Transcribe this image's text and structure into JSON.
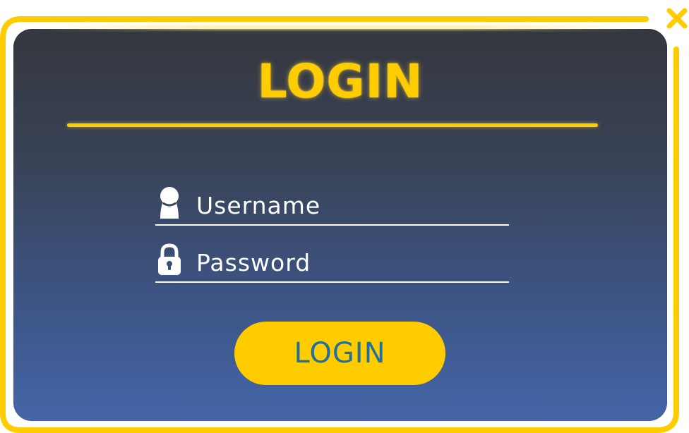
{
  "dialog": {
    "title": "LOGIN",
    "username": {
      "placeholder": "Username",
      "icon": "user-icon"
    },
    "password": {
      "placeholder": "Password",
      "icon": "lock-icon"
    },
    "submit_label": "LOGIN",
    "close_icon": "close-icon"
  },
  "colors": {
    "accent": "#ffcc00",
    "button_text": "#1f6fa0",
    "panel_top": "#34373e",
    "panel_bottom": "#4465a8",
    "field_text": "#ffffff"
  }
}
